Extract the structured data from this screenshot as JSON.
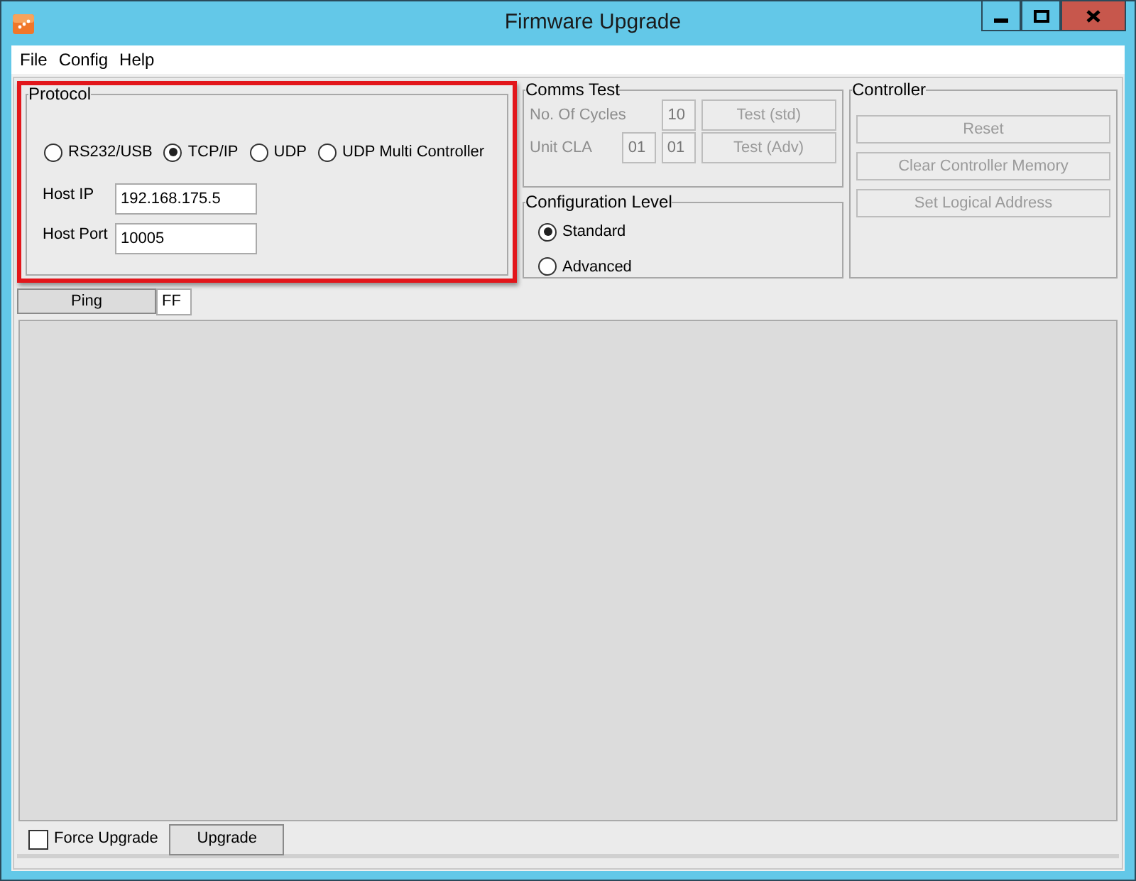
{
  "window": {
    "title": "Firmware Upgrade"
  },
  "menu": [
    "File",
    "Config",
    "Help"
  ],
  "protocol": {
    "title": "Protocol",
    "highlighted": true,
    "options": [
      {
        "label": "RS232/USB",
        "selected": false
      },
      {
        "label": "TCP/IP",
        "selected": true
      },
      {
        "label": "UDP",
        "selected": false
      },
      {
        "label": "UDP Multi Controller",
        "selected": false
      }
    ],
    "fields": [
      {
        "label": "Host IP",
        "value": "192.168.175.5"
      },
      {
        "label": "Host Port",
        "value": "10005"
      }
    ]
  },
  "ping": {
    "button": "Ping",
    "value": "FF"
  },
  "comms_test": {
    "title": "Comms Test",
    "disabled": true,
    "rows": [
      {
        "label": "No. Of Cycles",
        "values": [
          "10"
        ],
        "button": "Test (std)"
      },
      {
        "label": "Unit CLA",
        "values": [
          "01",
          "01"
        ],
        "button": "Test (Adv)"
      }
    ]
  },
  "configuration_level": {
    "title": "Configuration Level",
    "options": [
      {
        "label": "Standard",
        "selected": true
      },
      {
        "label": "Advanced",
        "selected": false
      }
    ]
  },
  "controller": {
    "title": "Controller",
    "buttons": [
      {
        "label": "Reset",
        "disabled": true
      },
      {
        "label": "Clear Controller Memory",
        "disabled": true
      },
      {
        "label": "Set Logical Address",
        "disabled": true
      }
    ]
  },
  "force_upgrade": {
    "label": "Force Upgrade",
    "checked": false
  },
  "upgrade_button": "Upgrade"
}
